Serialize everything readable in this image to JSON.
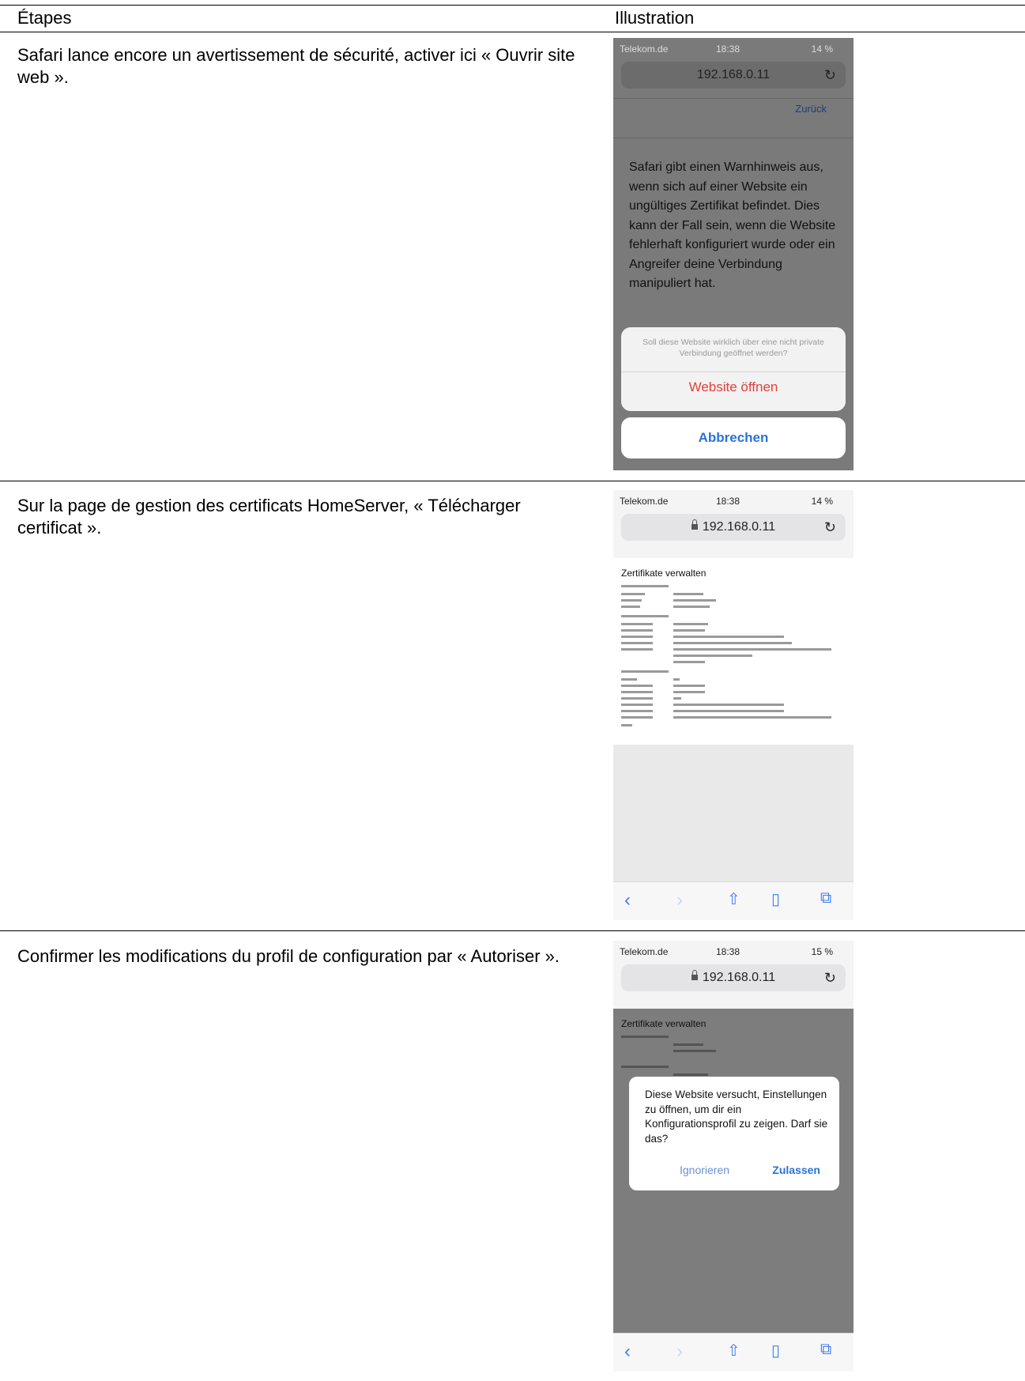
{
  "table": {
    "col_steps": "Étapes",
    "col_illustration": "Illustration"
  },
  "steps": [
    {
      "text": "Safari lance encore un avertissement de sécurité, activer ici « Ouvrir site web ».",
      "screen": {
        "carrier": "Telekom.de",
        "time": "18:38",
        "battery": "14 %",
        "url": "192.168.0.11",
        "back_link": "Zurück",
        "warning": "Safari gibt einen Warnhinweis aus, wenn sich auf einer Website ein ungültiges Zertifikat befindet. Dies kann der Fall sein, wenn die Website fehlerhaft konfiguriert wurde oder ein Angreifer deine Verbindung manipuliert hat.",
        "question": "Soll diese Website wirklich über eine nicht private Verbindung geöffnet werden?",
        "open_button": "Website öffnen",
        "cancel_button": "Abbrechen"
      }
    },
    {
      "text": "Sur la page de gestion des certificats HomeServer, « Télécharger certificat ».",
      "screen": {
        "carrier": "Telekom.de",
        "time": "18:38",
        "battery": "14 %",
        "url": "192.168.0.11",
        "page_title": "Zertifikate verwalten"
      }
    },
    {
      "text": "Confirmer les modifications du profil de configuration par « Autoriser ».",
      "screen": {
        "carrier": "Telekom.de",
        "time": "18:38",
        "battery": "15 %",
        "url": "192.168.0.11",
        "page_title": "Zertifikate verwalten",
        "dialog_text": "Diese Website versucht, Einstellungen zu öffnen, um dir ein Konfigurationsprofil zu zeigen. Darf sie das?",
        "ignore_button": "Ignorieren",
        "allow_button": "Zulassen"
      }
    }
  ]
}
